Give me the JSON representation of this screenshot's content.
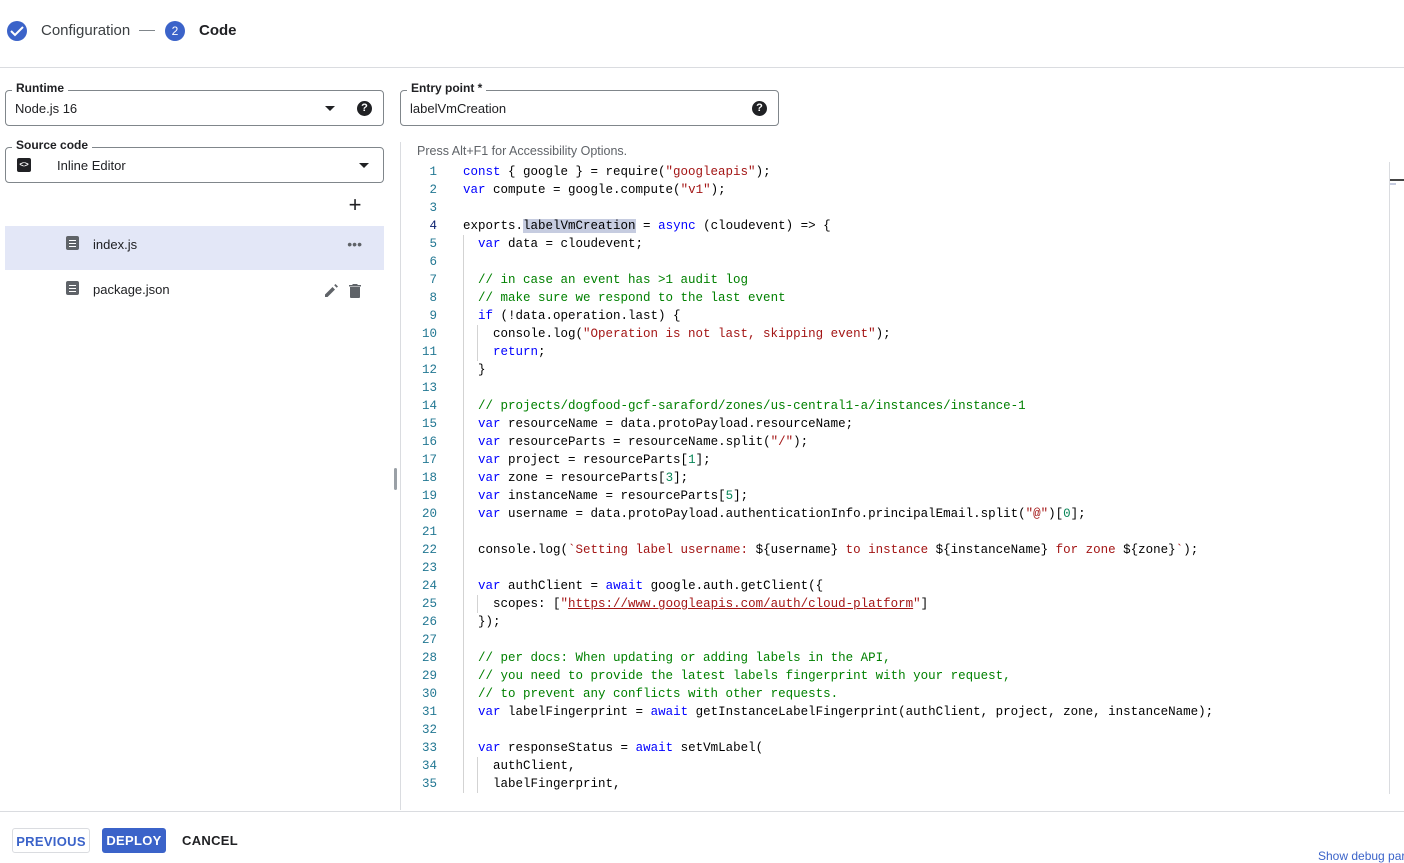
{
  "stepper": {
    "step1_label": "Configuration",
    "step2_number": "2",
    "step2_label": "Code"
  },
  "runtime": {
    "label": "Runtime",
    "value": "Node.js 16"
  },
  "entry_point": {
    "label": "Entry point *",
    "value": "labelVmCreation"
  },
  "source_code": {
    "label": "Source code",
    "value": "Inline Editor"
  },
  "files": [
    {
      "name": "index.js",
      "active": true
    },
    {
      "name": "package.json",
      "active": false
    }
  ],
  "editor": {
    "a11y_hint": "Press Alt+F1 for Accessibility Options.",
    "current_line": 4,
    "lines": [
      "const { google } = require(\"googleapis\");",
      "var compute = google.compute(\"v1\");",
      "",
      "exports.labelVmCreation = async (cloudevent) => {",
      "  var data = cloudevent;",
      "",
      "  // in case an event has >1 audit log",
      "  // make sure we respond to the last event",
      "  if (!data.operation.last) {",
      "    console.log(\"Operation is not last, skipping event\");",
      "    return;",
      "  }",
      "",
      "  // projects/dogfood-gcf-saraford/zones/us-central1-a/instances/instance-1",
      "  var resourceName = data.protoPayload.resourceName;",
      "  var resourceParts = resourceName.split(\"/\");",
      "  var project = resourceParts[1];",
      "  var zone = resourceParts[3];",
      "  var instanceName = resourceParts[5];",
      "  var username = data.protoPayload.authenticationInfo.principalEmail.split(\"@\")[0];",
      "",
      "  console.log(`Setting label username: ${username} to instance ${instanceName} for zone ${zone}`);",
      "",
      "  var authClient = await google.auth.getClient({",
      "    scopes: [\"https://www.googleapis.com/auth/cloud-platform\"]",
      "  });",
      "",
      "  // per docs: When updating or adding labels in the API,",
      "  // you need to provide the latest labels fingerprint with your request,",
      "  // to prevent any conflicts with other requests.",
      "  var labelFingerprint = await getInstanceLabelFingerprint(authClient, project, zone, instanceName);",
      "",
      "  var responseStatus = await setVmLabel(",
      "    authClient,",
      "    labelFingerprint,"
    ]
  },
  "footer": {
    "previous": "PREVIOUS",
    "deploy": "DEPLOY",
    "cancel": "CANCEL",
    "debug_link": "Show debug par"
  },
  "colors": {
    "accent": "#3b63c9",
    "active_file_bg": "#e3e7f7",
    "keyword": "#0000ff",
    "string": "#a31515",
    "comment": "#008000",
    "number": "#098658",
    "line_number": "#237893"
  }
}
